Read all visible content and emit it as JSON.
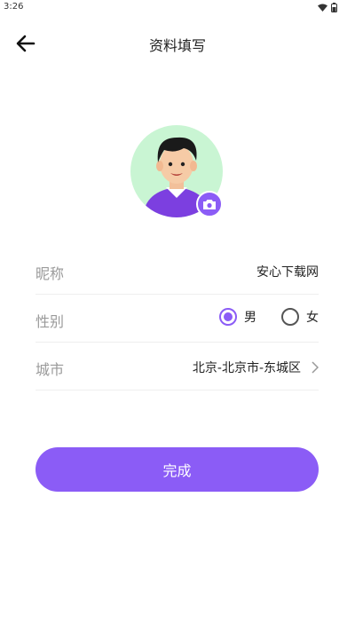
{
  "status_bar": {
    "time": "3:26"
  },
  "header": {
    "title": "资料填写"
  },
  "colors": {
    "accent": "#8b5cf6",
    "avatar_bg": "#c9f5d3"
  },
  "form": {
    "nickname": {
      "label": "昵称",
      "value": "安心下载网"
    },
    "gender": {
      "label": "性别",
      "options": [
        "男",
        "女"
      ],
      "selected": "男"
    },
    "city": {
      "label": "城市",
      "value": "北京-北京市-东城区"
    }
  },
  "actions": {
    "submit_label": "完成"
  }
}
